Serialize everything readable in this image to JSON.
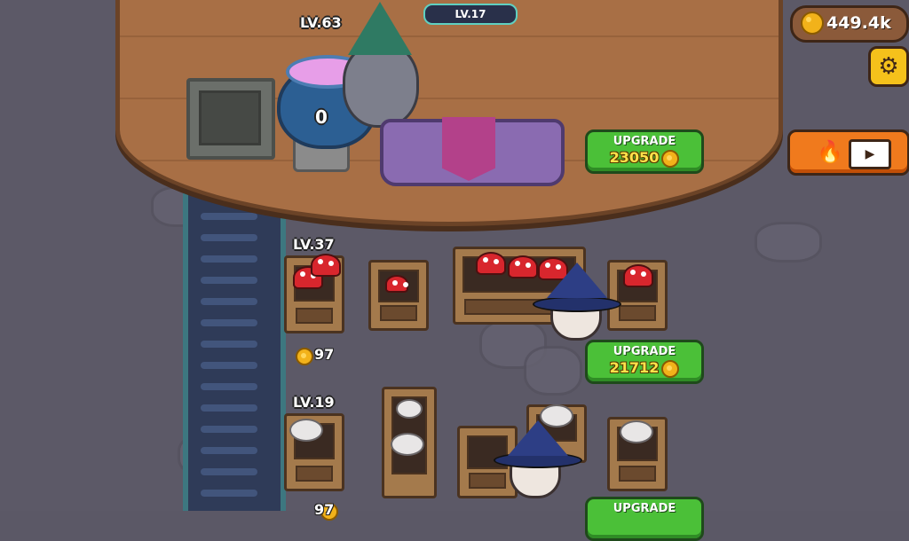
{
  "hud": {
    "coins": "449.4k",
    "settings_icon": "gear-icon",
    "boost_icons": [
      "fire-icon",
      "video-icon"
    ]
  },
  "top_area": {
    "level_pill": "LV.17",
    "cauldron": {
      "level": "LV.63",
      "value": "0"
    },
    "upgrade": {
      "label": "UPGRADE",
      "cost": "23050"
    }
  },
  "stations": [
    {
      "level": "LV.37",
      "income": "97",
      "upgrade": {
        "label": "UPGRADE",
        "cost": "21712"
      }
    },
    {
      "level": "LV.19",
      "income": "97",
      "upgrade": {
        "label": "UPGRADE"
      }
    }
  ],
  "colors": {
    "accent_green": "#4bc038",
    "coin_gold": "#f2b21a",
    "boost_orange": "#f07a1d"
  }
}
